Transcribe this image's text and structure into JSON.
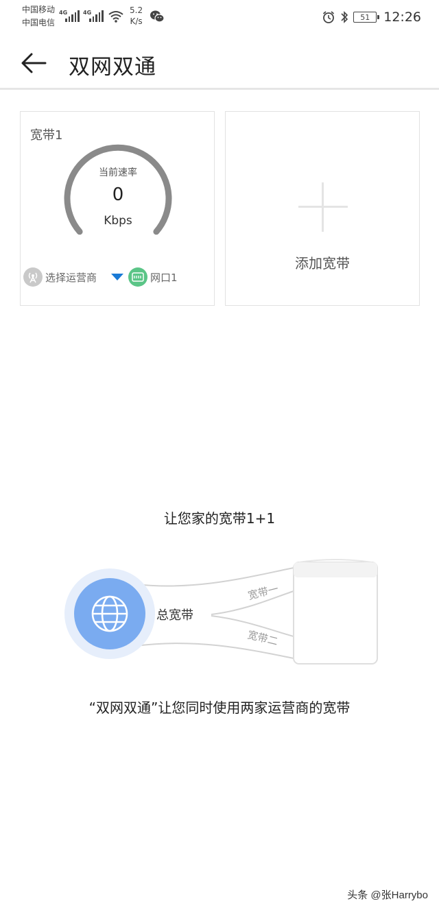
{
  "status_bar": {
    "carrier_1": "中国移动",
    "carrier_2": "中国电信",
    "network_1": "4G",
    "network_2": "4G",
    "speed_value": "5.2",
    "speed_unit": "K/s",
    "battery": "51",
    "time": "12:26"
  },
  "app_bar": {
    "title": "双网双通",
    "back_icon": "arrow-left-icon"
  },
  "broadband_card": {
    "title": "宽带1",
    "gauge_label": "当前速率",
    "rate_value": "0",
    "rate_unit": "Kbps",
    "isp_label": "选择运营商",
    "port_label": "网口1"
  },
  "add_card": {
    "label": "添加宽带"
  },
  "promo": {
    "title": "让您家的宽带1+1",
    "total_label": "总宽带",
    "line_1_label": "宽带一",
    "line_2_label": "宽带二",
    "description": "“双网双通”让您同时使用两家运营商的宽带"
  },
  "watermark": "头条 @张Harrybo",
  "colors": {
    "gauge_arc": "#8a8a8a",
    "isp_icon": "#c9c9c9",
    "port_icon": "#5bc587",
    "dropdown": "#1a7ad6",
    "globe_bg": "#7aabf0",
    "globe_halo": "#e6eefb"
  }
}
